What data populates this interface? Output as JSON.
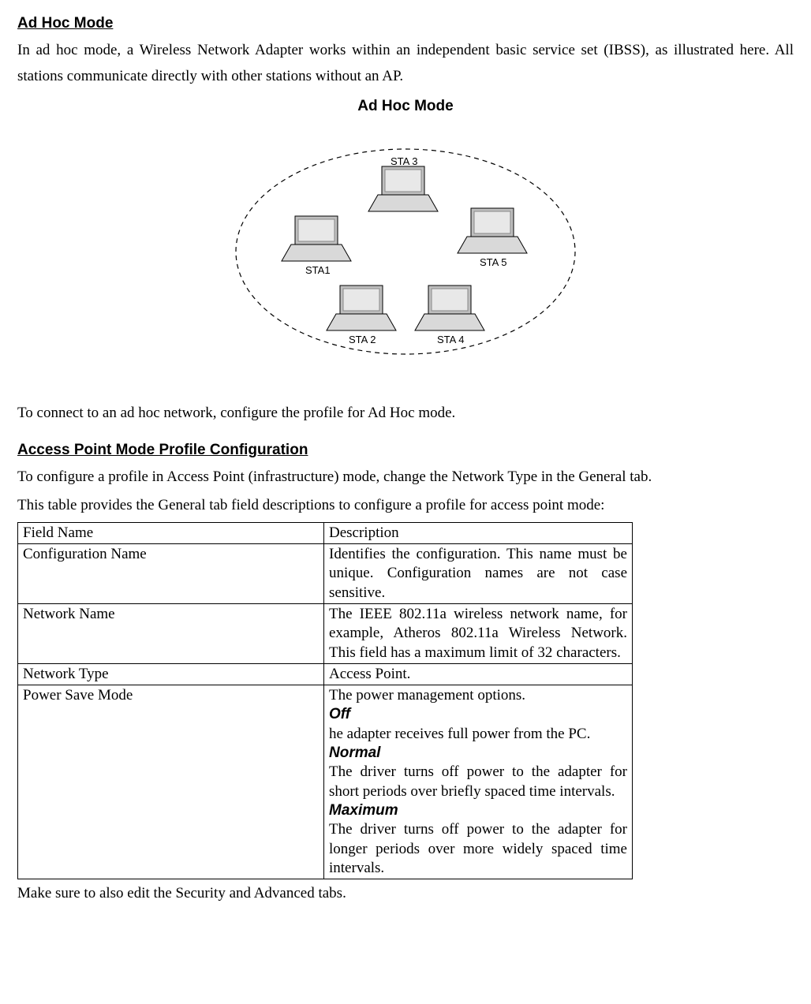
{
  "section1": {
    "title": "Ad Hoc Mode",
    "intro": "In ad hoc mode, a Wireless Network Adapter works within an independent basic service set (IBSS), as illustrated here. All stations communicate directly with other stations without an AP.",
    "figure_title": "Ad Hoc Mode",
    "note": "To connect to an ad hoc network, configure the profile for Ad Hoc mode."
  },
  "diagram": {
    "labels": {
      "sta1": "STA1",
      "sta2": "STA 2",
      "sta3": "STA 3",
      "sta4": "STA 4",
      "sta5": "STA 5"
    }
  },
  "section2": {
    "title": "Access Point Mode Profile Configuration",
    "intro1": "To configure a profile in Access Point (infrastructure) mode, change the Network Type in the General tab.",
    "intro2": "This table provides the General tab field descriptions to configure a profile for access point mode:",
    "outro": "Make sure to also edit the Security and Advanced tabs."
  },
  "table": {
    "header_field": "Field Name",
    "header_desc": "Description",
    "rows": {
      "r1_name": "Configuration Name",
      "r1_desc": "Identifies the configuration. This name must be unique. Configuration names are not case sensitive.",
      "r2_name": "Network Name",
      "r2_desc": "The IEEE 802.11a wireless network name, for example, Atheros 802.11a Wireless Network. This field has a maximum limit of 32 characters.",
      "r3_name": "Network Type",
      "r3_desc": "Access Point.",
      "r4_name": "Power Save Mode",
      "r4_desc_intro": "The power management options.",
      "r4_off_label": "Off",
      "r4_off_desc": "he adapter receives full power from the PC.",
      "r4_normal_label": "Normal",
      "r4_normal_desc": "The driver turns off power to the adapter for short periods over briefly spaced time intervals.",
      "r4_max_label": "Maximum",
      "r4_max_desc": "The driver turns off power to the adapter for longer periods over more widely spaced time intervals."
    }
  }
}
